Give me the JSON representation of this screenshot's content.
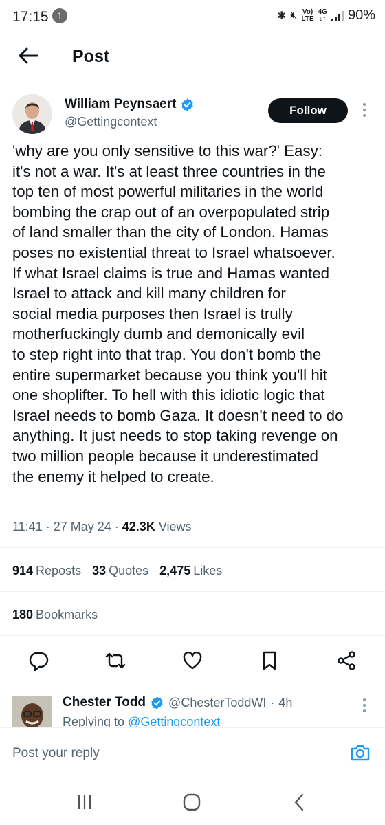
{
  "status_bar": {
    "time": "17:15",
    "notification_count": "1",
    "volte": "Vo)",
    "lte": "LTE",
    "network": "4G",
    "battery": "90%"
  },
  "header": {
    "title": "Post"
  },
  "post": {
    "author_name": "William Peynsaert",
    "author_handle": "@Gettingcontext",
    "follow_label": "Follow",
    "text": "'why are you only sensitive to this war?' Easy:\nit's not a war. It's at least three countries in the\ntop ten of most powerful militaries in the world\nbombing the crap out of an overpopulated strip\nof land smaller than the city of London. Hamas\nposes no existential threat to Israel whatsoever.\nIf what Israel claims is true and Hamas wanted\nIsrael to attack and kill many children for\nsocial media purposes then Israel is trully\nmotherfuckingly dumb and demonically evil\nto step right into that trap. You don't bomb the\nentire supermarket because you think you'll hit\none shoplifter. To hell with this idiotic logic that\nIsrael needs to bomb Gaza. It doesn't need to do\nanything. It just needs to stop taking revenge on\ntwo million people because it underestimated\nthe enemy it helped to create.",
    "time": "11:41",
    "date": "27 May 24",
    "views_count": "42.3K",
    "views_label": "Views",
    "reposts_count": "914",
    "reposts_label": "Reposts",
    "quotes_count": "33",
    "quotes_label": "Quotes",
    "likes_count": "2,475",
    "likes_label": "Likes",
    "bookmarks_count": "180",
    "bookmarks_label": "Bookmarks"
  },
  "reply": {
    "author_name": "Chester Todd",
    "author_handle": "@ChesterToddWI",
    "age": "4h",
    "replying_prefix": "Replying to",
    "replying_to": "@Gettingcontext"
  },
  "reply_bar": {
    "placeholder": "Post your reply"
  },
  "colors": {
    "accent": "#1d9bf0",
    "text": "#0f1419",
    "muted": "#536471",
    "button_dark": "#0f1419"
  },
  "icons": [
    "back-arrow-icon",
    "verified-badge-icon",
    "more-dots-icon",
    "reply-icon",
    "repost-icon",
    "like-icon",
    "bookmark-icon",
    "share-icon",
    "camera-icon",
    "recents-icon",
    "home-icon",
    "nav-back-icon"
  ]
}
